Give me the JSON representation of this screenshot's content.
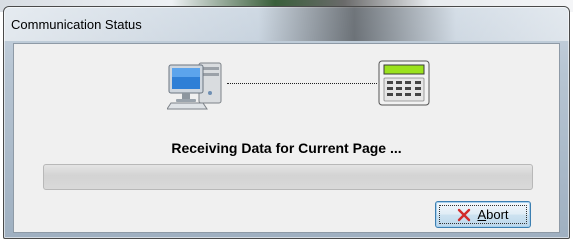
{
  "window": {
    "title": "Communication Status"
  },
  "dialog": {
    "status_message": "Receiving Data for Current Page ...",
    "progress_percent": 0,
    "abort_button": {
      "mnemonic": "A",
      "rest": "bort"
    }
  },
  "icons": {
    "computer": "computer-icon",
    "device": "keypad-panel-icon",
    "abort": "red-x-icon"
  },
  "colors": {
    "abort_icon": "#d22b2b",
    "device_screen": "#9be21d",
    "button_border": "#3c7fb1"
  }
}
